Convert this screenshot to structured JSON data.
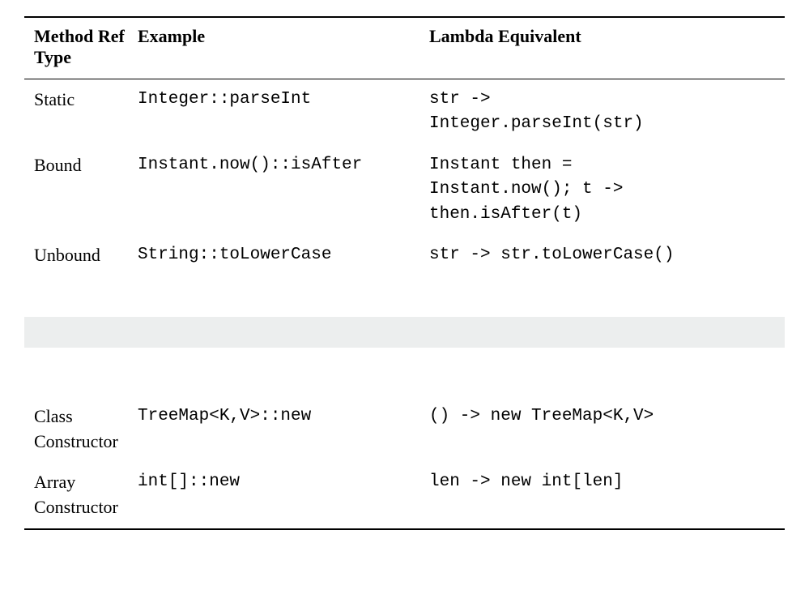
{
  "headers": {
    "col1": "Method Ref Type",
    "col2": "Example",
    "col3": "Lambda Equivalent"
  },
  "rows_top": [
    {
      "type": "Static",
      "example": "Integer::parseInt",
      "lambda": "str ->\nInteger.parseInt(str)"
    },
    {
      "type": "Bound",
      "example": "Instant.now()::isAfter",
      "lambda": "Instant then =\nInstant.now(); t ->\nthen.isAfter(t)"
    },
    {
      "type": "Unbound",
      "example": "String::toLowerCase",
      "lambda": "str -> str.toLowerCase()"
    }
  ],
  "rows_bottom": [
    {
      "type": "Class Constructor",
      "example": "TreeMap<K,V>::new",
      "lambda": "() -> new TreeMap<K,V>"
    },
    {
      "type": "Array Constructor",
      "example": "int[]::new",
      "lambda": "len -> new int[len]"
    }
  ]
}
